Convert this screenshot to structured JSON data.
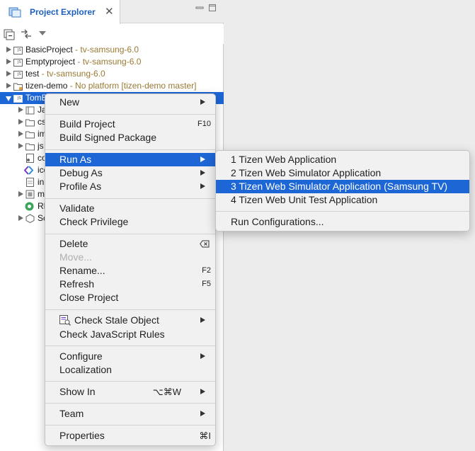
{
  "explorer": {
    "tab_title": "Project Explorer",
    "close_glyph": "✕",
    "tree": [
      {
        "name": "BasicProject",
        "meta": " - tv-samsung-6.0"
      },
      {
        "name": "Emptyproject",
        "meta": " - tv-samsung-6.0"
      },
      {
        "name": "test",
        "meta": " - tv-samsung-6.0"
      },
      {
        "name": "tizen-demo",
        "meta": " - No platform [tizen-demo master]"
      },
      {
        "name": "TomE",
        "meta": ""
      },
      {
        "name": "Ja",
        "meta": ""
      },
      {
        "name": "cs",
        "meta": ""
      },
      {
        "name": "im",
        "meta": ""
      },
      {
        "name": "js",
        "meta": ""
      },
      {
        "name": "co",
        "meta": ""
      },
      {
        "name": "ico",
        "meta": ""
      },
      {
        "name": "in",
        "meta": ""
      },
      {
        "name": "m",
        "meta": ""
      },
      {
        "name": "RE",
        "meta": ""
      },
      {
        "name": "Sc",
        "meta": ""
      }
    ]
  },
  "context_menu": {
    "new": "New",
    "build_project": "Build Project",
    "build_project_sc": "F10",
    "build_signed": "Build Signed Package",
    "run_as": "Run As",
    "debug_as": "Debug As",
    "profile_as": "Profile As",
    "validate": "Validate",
    "check_privilege": "Check Privilege",
    "delete": "Delete",
    "move": "Move...",
    "rename": "Rename...",
    "rename_sc": "F2",
    "refresh": "Refresh",
    "refresh_sc": "F5",
    "close_project": "Close Project",
    "check_stale": "Check Stale Object",
    "check_js": "Check JavaScript Rules",
    "configure": "Configure",
    "localization": "Localization",
    "show_in": "Show In",
    "show_in_sc": "⌥⌘W",
    "team": "Team",
    "properties": "Properties",
    "properties_sc": "⌘I"
  },
  "run_as_submenu": {
    "items": [
      "1 Tizen Web Application",
      "2 Tizen Web Simulator Application",
      "3 Tizen Web Simulator Application (Samsung TV)",
      "4 Tizen Web Unit Test Application"
    ],
    "run_configurations": "Run Configurations..."
  },
  "colors": {
    "selection": "#1d66d6",
    "tab_title": "#1d5fbf",
    "meta_text": "#9a7a34"
  }
}
